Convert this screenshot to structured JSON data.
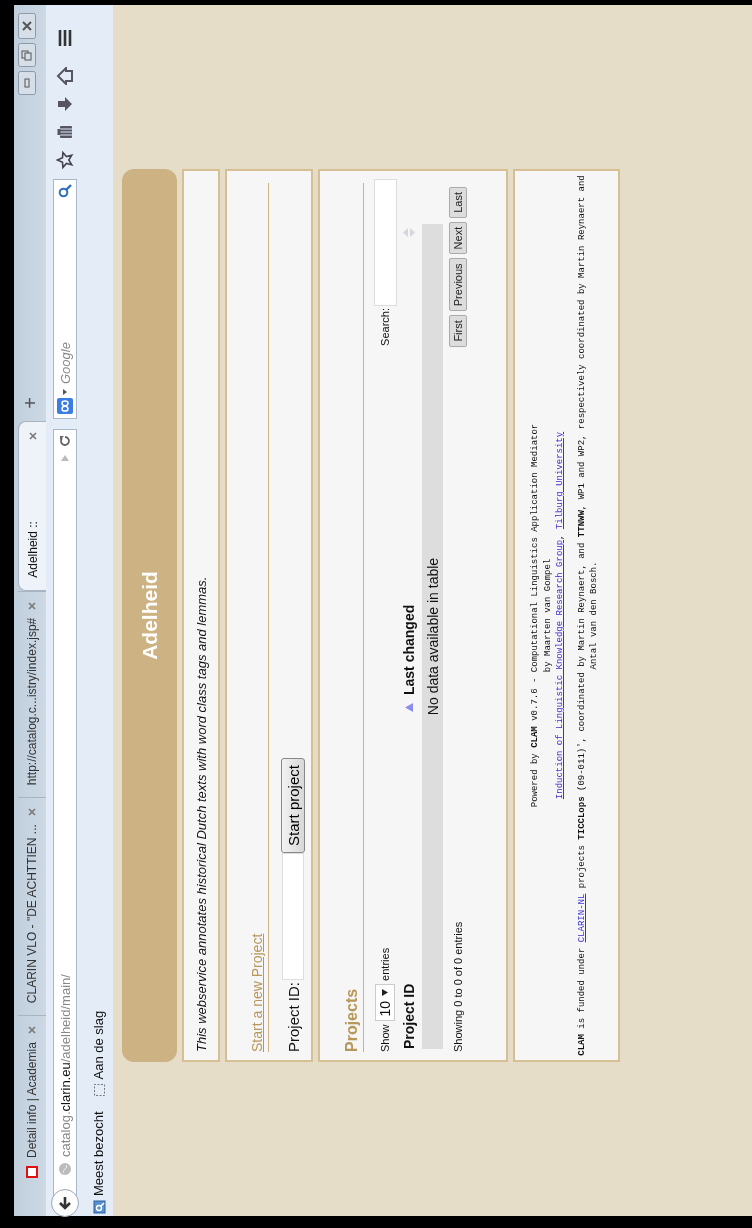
{
  "browser": {
    "tabs": [
      {
        "title": "Detail info | Academia",
        "favicon": true,
        "selected": false
      },
      {
        "title": "CLARIN VLO - \"DE ACHTTIEN ...",
        "favicon": false,
        "selected": false
      },
      {
        "title": "http://catalog.c...istry/index.jsp#",
        "favicon": false,
        "selected": false
      },
      {
        "title": "Adelheid ::",
        "favicon": false,
        "selected": true
      }
    ],
    "new_tab": "+",
    "address": {
      "prefix": "catalog.",
      "host": "clarin.eu",
      "path": "/adelheid/main/"
    },
    "search": {
      "placeholder": "Google"
    },
    "bookmarks": [
      {
        "label": "Meest bezocht",
        "kind": "smart"
      },
      {
        "label": "Aan de slag",
        "kind": "folder"
      }
    ]
  },
  "page": {
    "title": "Adelheid",
    "description": "This webservice annotates historical Dutch texts with word class tags and lemmas.",
    "new_project": {
      "heading": "Start a new Project",
      "label": "Project ID:",
      "button": "Start project"
    },
    "projects": {
      "heading": "Projects",
      "show_label": "Show",
      "length": "10",
      "entries_label": "entries",
      "search_label": "Search:",
      "columns": [
        {
          "label": "Project ID",
          "sorted": true
        },
        {
          "label": "Last changed",
          "sorted": false
        }
      ],
      "empty": "No data available in table",
      "info": "Showing 0 to 0 of 0 entries",
      "pager": [
        "First",
        "Previous",
        "Next",
        "Last"
      ]
    },
    "footer": {
      "paragraphs": [
        {
          "lines": [
            [
              {
                "kind": "text",
                "text": "Powered by **CLAM** v0.7.6 - Computational Linguistics Application Mediator"
              }
            ],
            [
              {
                "kind": "text",
                "text": "by Maarten van Gompel"
              }
            ],
            [
              {
                "kind": "link",
                "text": "Induction of Linguistic Knowledge Research Group"
              },
              {
                "kind": "text",
                "text": ", "
              },
              {
                "kind": "link",
                "text": "Tilburg University"
              }
            ]
          ]
        },
        {
          "lines": [
            [
              {
                "kind": "text",
                "text": "**CLAM** is funded under "
              },
              {
                "kind": "link",
                "text": "CLARIN-NL"
              },
              {
                "kind": "text",
                "text": " projects **TICCLops** (09-011)', coordinated by Martin Reynaert, and **TTNWW**, WP1 and WP2, respectively coordinated by Martin Reynaert and Antal van den Bosch."
              }
            ]
          ]
        }
      ]
    }
  }
}
